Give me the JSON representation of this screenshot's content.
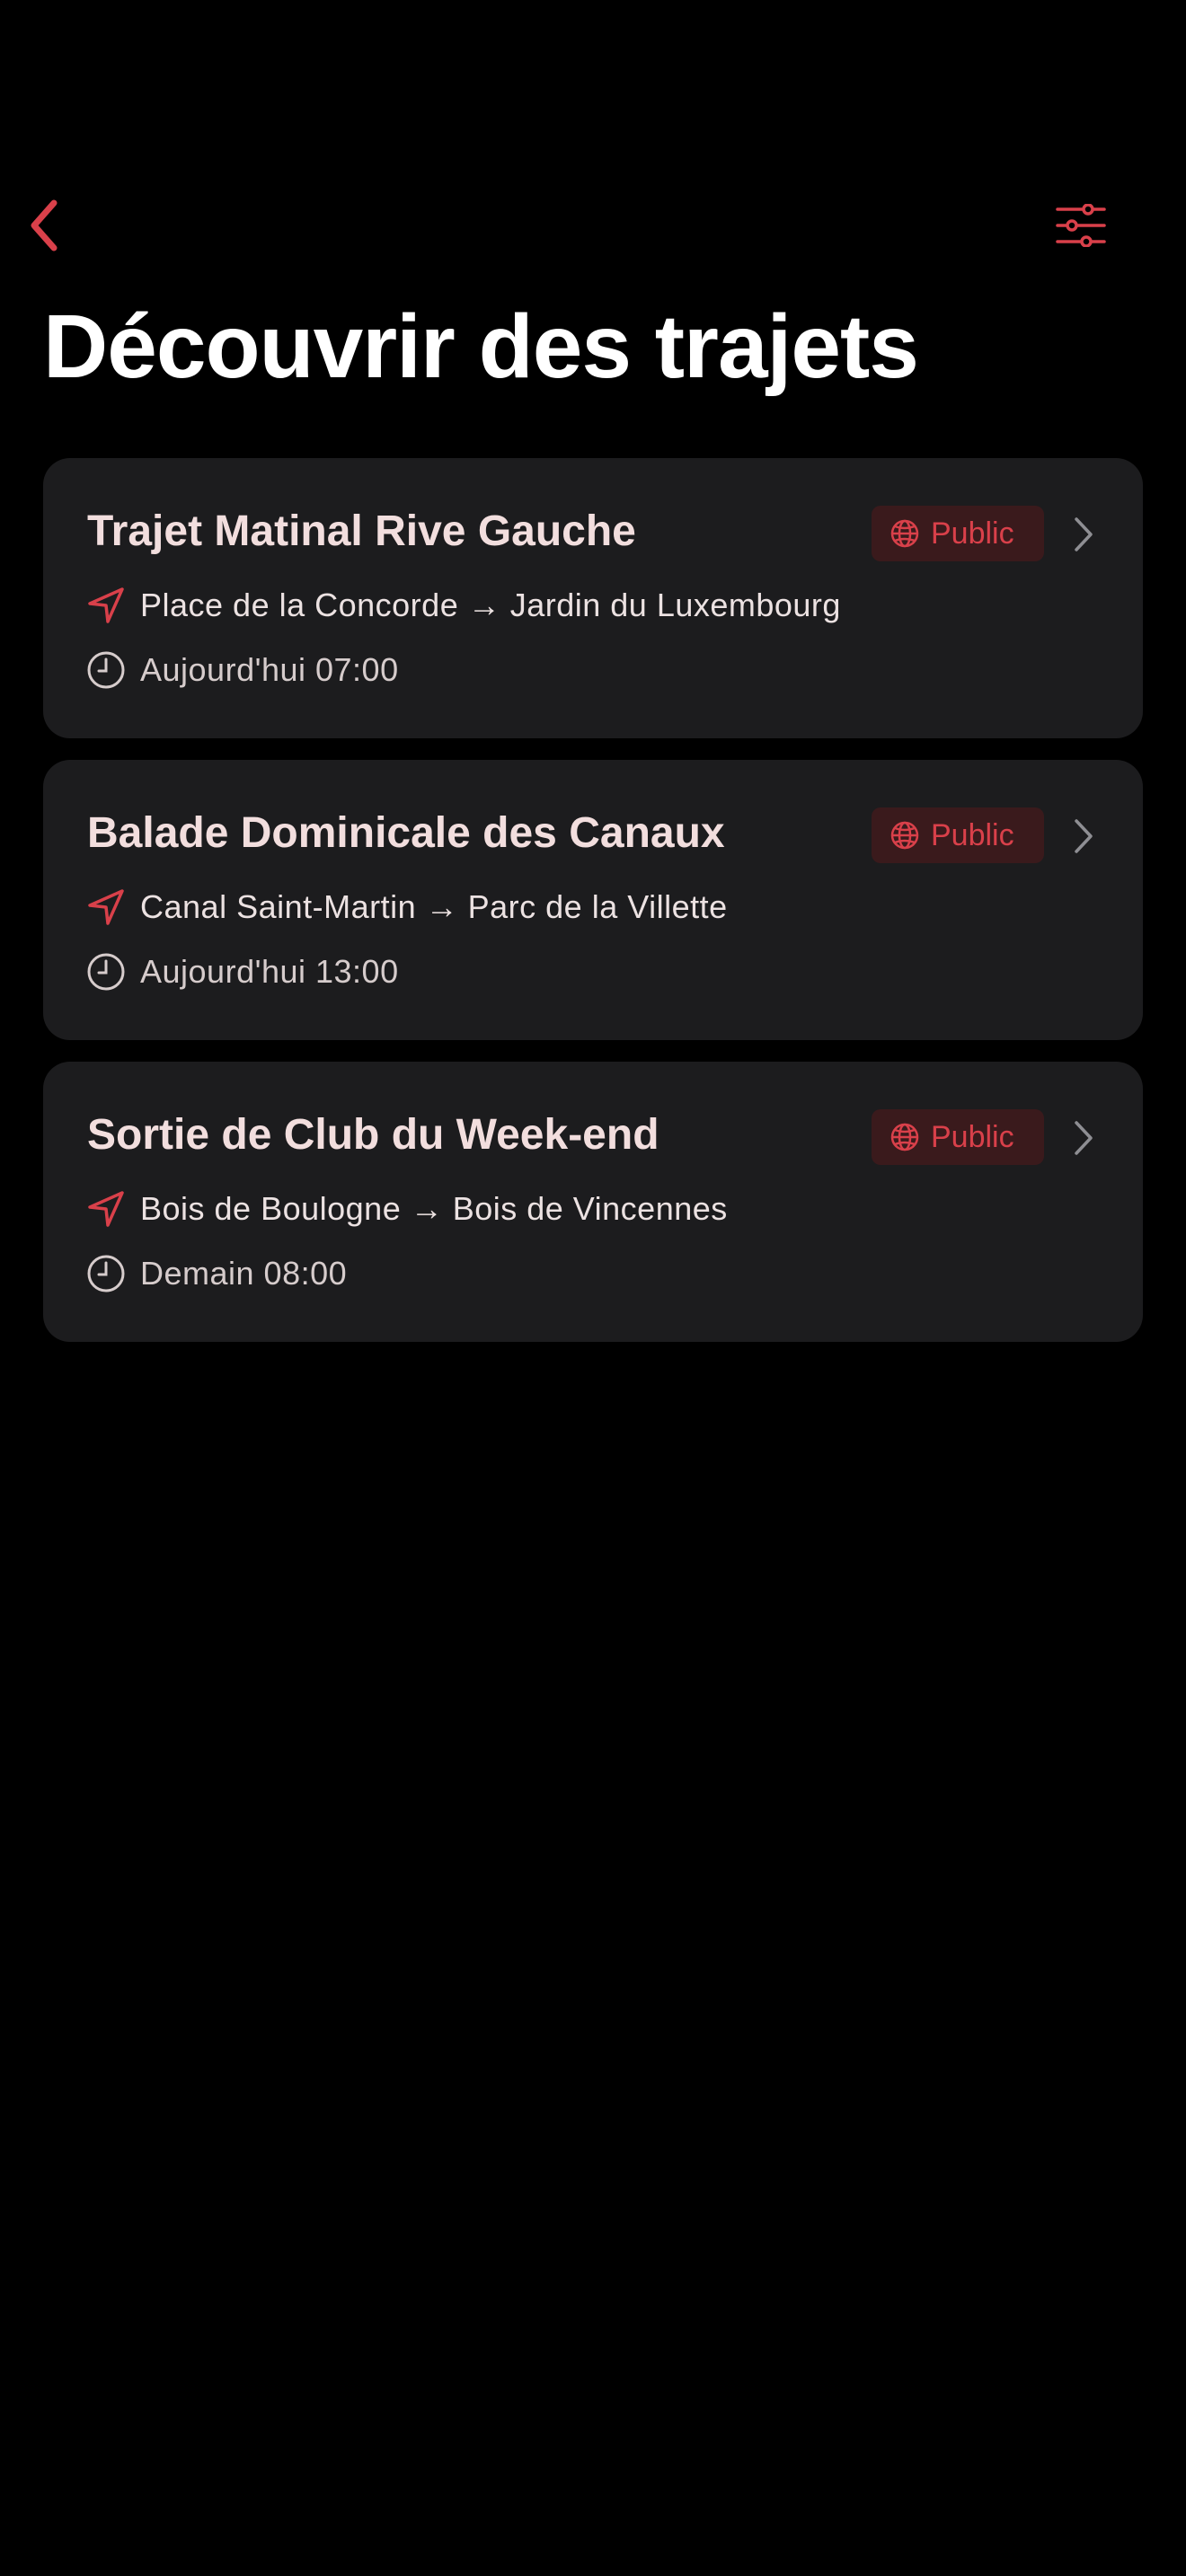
{
  "nav": {
    "back_icon": "chevron-left-icon",
    "filter_icon": "sliders-icon"
  },
  "page": {
    "title": "Découvrir des trajets"
  },
  "colors": {
    "accent": "#d9404a",
    "card_background": "#1c1c1e",
    "badge_background": "#3a1a1c",
    "background": "#000000"
  },
  "trips": [
    {
      "title": "Trajet Matinal Rive Gauche",
      "visibility": "Public",
      "visibility_icon": "globe-icon",
      "route_icon": "location-arrow-icon",
      "route": "Place de la Concorde → Jardin du Luxembourg",
      "time_icon": "clock-icon",
      "time": "Aujourd'hui 07:00"
    },
    {
      "title": "Balade Dominicale des Canaux",
      "visibility": "Public",
      "visibility_icon": "globe-icon",
      "route_icon": "location-arrow-icon",
      "route": "Canal Saint-Martin → Parc de la Villette",
      "time_icon": "clock-icon",
      "time": "Aujourd'hui 13:00"
    },
    {
      "title": "Sortie de Club du Week-end",
      "visibility": "Public",
      "visibility_icon": "globe-icon",
      "route_icon": "location-arrow-icon",
      "route": "Bois de Boulogne → Bois de Vincennes",
      "time_icon": "clock-icon",
      "time": "Demain 08:00"
    }
  ]
}
